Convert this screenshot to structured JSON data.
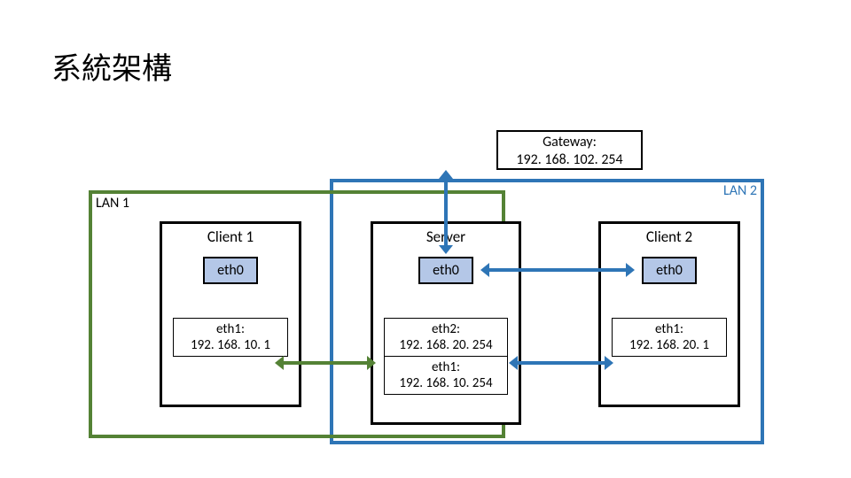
{
  "title": "系統架構",
  "gateway": {
    "label": "Gateway:",
    "ip": "192. 168. 102. 254"
  },
  "lan1": {
    "label": "LAN 1"
  },
  "lan2": {
    "label": "LAN 2"
  },
  "client1": {
    "title": "Client 1",
    "eth0": "eth0",
    "if1": {
      "name": "eth1:",
      "ip": "192. 168. 10. 1"
    }
  },
  "server": {
    "title": "Server",
    "eth0": "eth0",
    "if1": {
      "name": "eth2:",
      "ip": "192. 168. 20. 254"
    },
    "if2": {
      "name": "eth1:",
      "ip": "192. 168. 10. 254"
    }
  },
  "client2": {
    "title": "Client 2",
    "eth0": "eth0",
    "if1": {
      "name": "eth1:",
      "ip": "192. 168. 20. 1"
    }
  }
}
